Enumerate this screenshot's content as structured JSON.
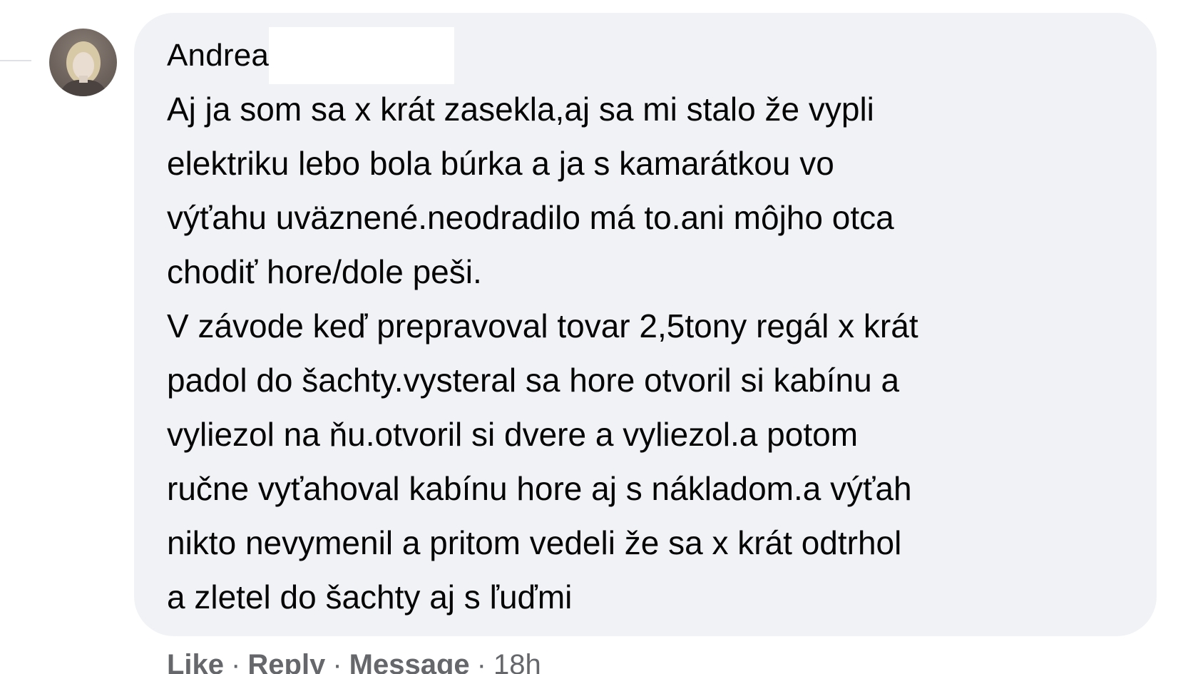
{
  "comment": {
    "author_name": "Andrea",
    "text_lines": [
      "Aj ja som sa x krát zasekla,aj sa mi stalo že vypli",
      "elektriku lebo bola búrka a ja s kamarátkou vo",
      "výťahu uväznené.neodradilo má to.ani môjho otca",
      "chodiť hore/dole peši.",
      "V závode keď prepravoval tovar 2,5tony regál x krát",
      "padol do šachty.vysteral sa hore otvoril si kabínu a",
      "vyliezol na ňu.otvoril si dvere a vyliezol.a potom",
      "ručne vyťahoval kabínu hore aj s nákladom.a výťah",
      "nikto nevymenil a pritom vedeli že sa x krát odtrhol",
      "a zletel do šachty aj s ľuďmi"
    ],
    "actions": {
      "like_label": "Like",
      "reply_label": "Reply",
      "message_label": "Message",
      "separator": "·",
      "timestamp": "18h"
    },
    "avatar_icon": "user-avatar-photo"
  },
  "colors": {
    "bubble_background": "#f0f2f5",
    "text_primary": "#050505",
    "text_secondary": "#65676b"
  }
}
